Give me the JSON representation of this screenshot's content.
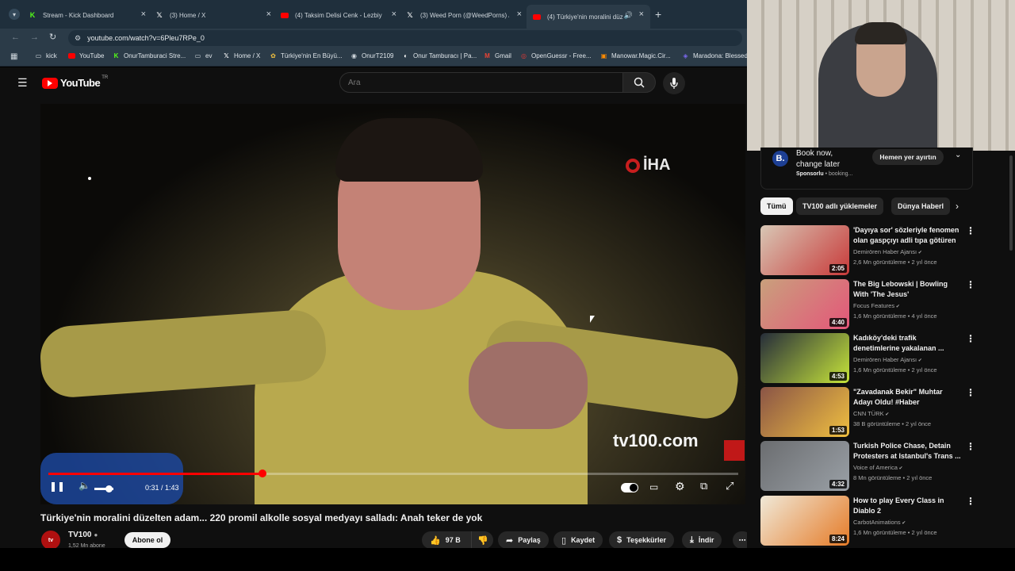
{
  "browser": {
    "tabs": [
      {
        "title": "Stream - Kick Dashboard",
        "icon": "kick-icon",
        "color": "#53fc18"
      },
      {
        "title": "(3) Home / X",
        "icon": "x-icon",
        "color": "#ffffff"
      },
      {
        "title": "(4) Taksim Delisi Cenk - Lezbiy",
        "icon": "youtube-icon",
        "color": "#ff0000"
      },
      {
        "title": "(3) Weed Porn (@WeedPorns) /",
        "icon": "x-icon",
        "color": "#ffffff"
      },
      {
        "title": "(4) Türkiye'nin moralini düz",
        "icon": "youtube-icon",
        "color": "#ff0000"
      }
    ],
    "url": "youtube.com/watch?v=6Pleu7RPe_0",
    "bookmarks": [
      {
        "label": "kick",
        "icon": "folder-icon"
      },
      {
        "label": "YouTube",
        "icon": "youtube-icon"
      },
      {
        "label": "OnurTamburaci Stre...",
        "icon": "kick-icon"
      },
      {
        "label": "ev",
        "icon": "folder-icon"
      },
      {
        "label": "Home / X",
        "icon": "x-icon"
      },
      {
        "label": "Türkiye'nin En Büyü...",
        "icon": "site-icon"
      },
      {
        "label": "OnurT2109",
        "icon": "globe-icon"
      },
      {
        "label": "Onur Tamburacı | Pa...",
        "icon": "site-icon"
      },
      {
        "label": "Gmail",
        "icon": "gmail-icon"
      },
      {
        "label": "OpenGuessr - Free...",
        "icon": "site-icon"
      },
      {
        "label": "Manowar.Magic.Cir...",
        "icon": "site-icon"
      },
      {
        "label": "Maradona: Blessed",
        "icon": "site-icon"
      }
    ]
  },
  "youtube": {
    "logo_text": "YouTube",
    "country": "TR",
    "search_placeholder": "Ara",
    "player": {
      "watermark": "İHA",
      "channel_watermark": "tv100.com",
      "time": "0:31 / 1:43",
      "progress": 0.31
    },
    "video_title": "Türkiye'nin moralini düzelten adam... 220 promil alkolle sosyal medyayı salladı: Anah teker de yok",
    "channel": {
      "name": "TV100",
      "subs": "1,52 Mn abone",
      "subscribe_label": "Abone ol"
    },
    "actions": {
      "likes": "97 B",
      "share": "Paylaş",
      "save": "Kaydet",
      "thanks": "Teşekkürler",
      "download": "İndir"
    }
  },
  "sidebar": {
    "ad": {
      "title_line1": "Book now,",
      "title_line2": "change later",
      "sponsored": "Sponsorlu",
      "domain": "booking...",
      "cta": "Hemen yer ayırtın"
    },
    "chips": [
      "Tümü",
      "TV100 adlı yüklemeler",
      "Dünya Haberl"
    ],
    "videos": [
      {
        "title": "'Dayıya sor' sözleriyle fenomen olan gaspçıyı adli tıpa götüren ...",
        "channel": "Demirören Haber Ajansı",
        "meta": "2,6 Mn görüntüleme • 2 yıl önce",
        "duration": "2:05"
      },
      {
        "title": "The Big Lebowski | Bowling With 'The Jesus'",
        "channel": "Focus Features",
        "meta": "1,6 Mn görüntüleme • 4 yıl önce",
        "duration": "4:40"
      },
      {
        "title": "Kadıköy'deki trafik denetimlerine yakalanan ...",
        "channel": "Demirören Haber Ajansı",
        "meta": "1,6 Mn görüntüleme • 2 yıl önce",
        "duration": "4:53"
      },
      {
        "title": "\"Zavadanak Bekir\" Muhtar Adayı Oldu! #Haber",
        "channel": "CNN TÜRK",
        "meta": "38 B görüntüleme • 2 yıl önce",
        "duration": "1:53"
      },
      {
        "title": "Turkish Police Chase, Detain Protesters at Istanbul's Trans ...",
        "channel": "Voice of America",
        "meta": "8 Mn görüntüleme • 2 yıl önce",
        "duration": "4:32"
      },
      {
        "title": "How to play Every Class in Diablo 2",
        "channel": "CarbotAnimations",
        "meta": "1,6 Mn görüntüleme • 2 yıl önce",
        "duration": "8:24"
      }
    ]
  },
  "colors": {
    "yt_red": "#ff0000",
    "background": "#0f0f0f",
    "chrome": "#1f2f3c"
  }
}
